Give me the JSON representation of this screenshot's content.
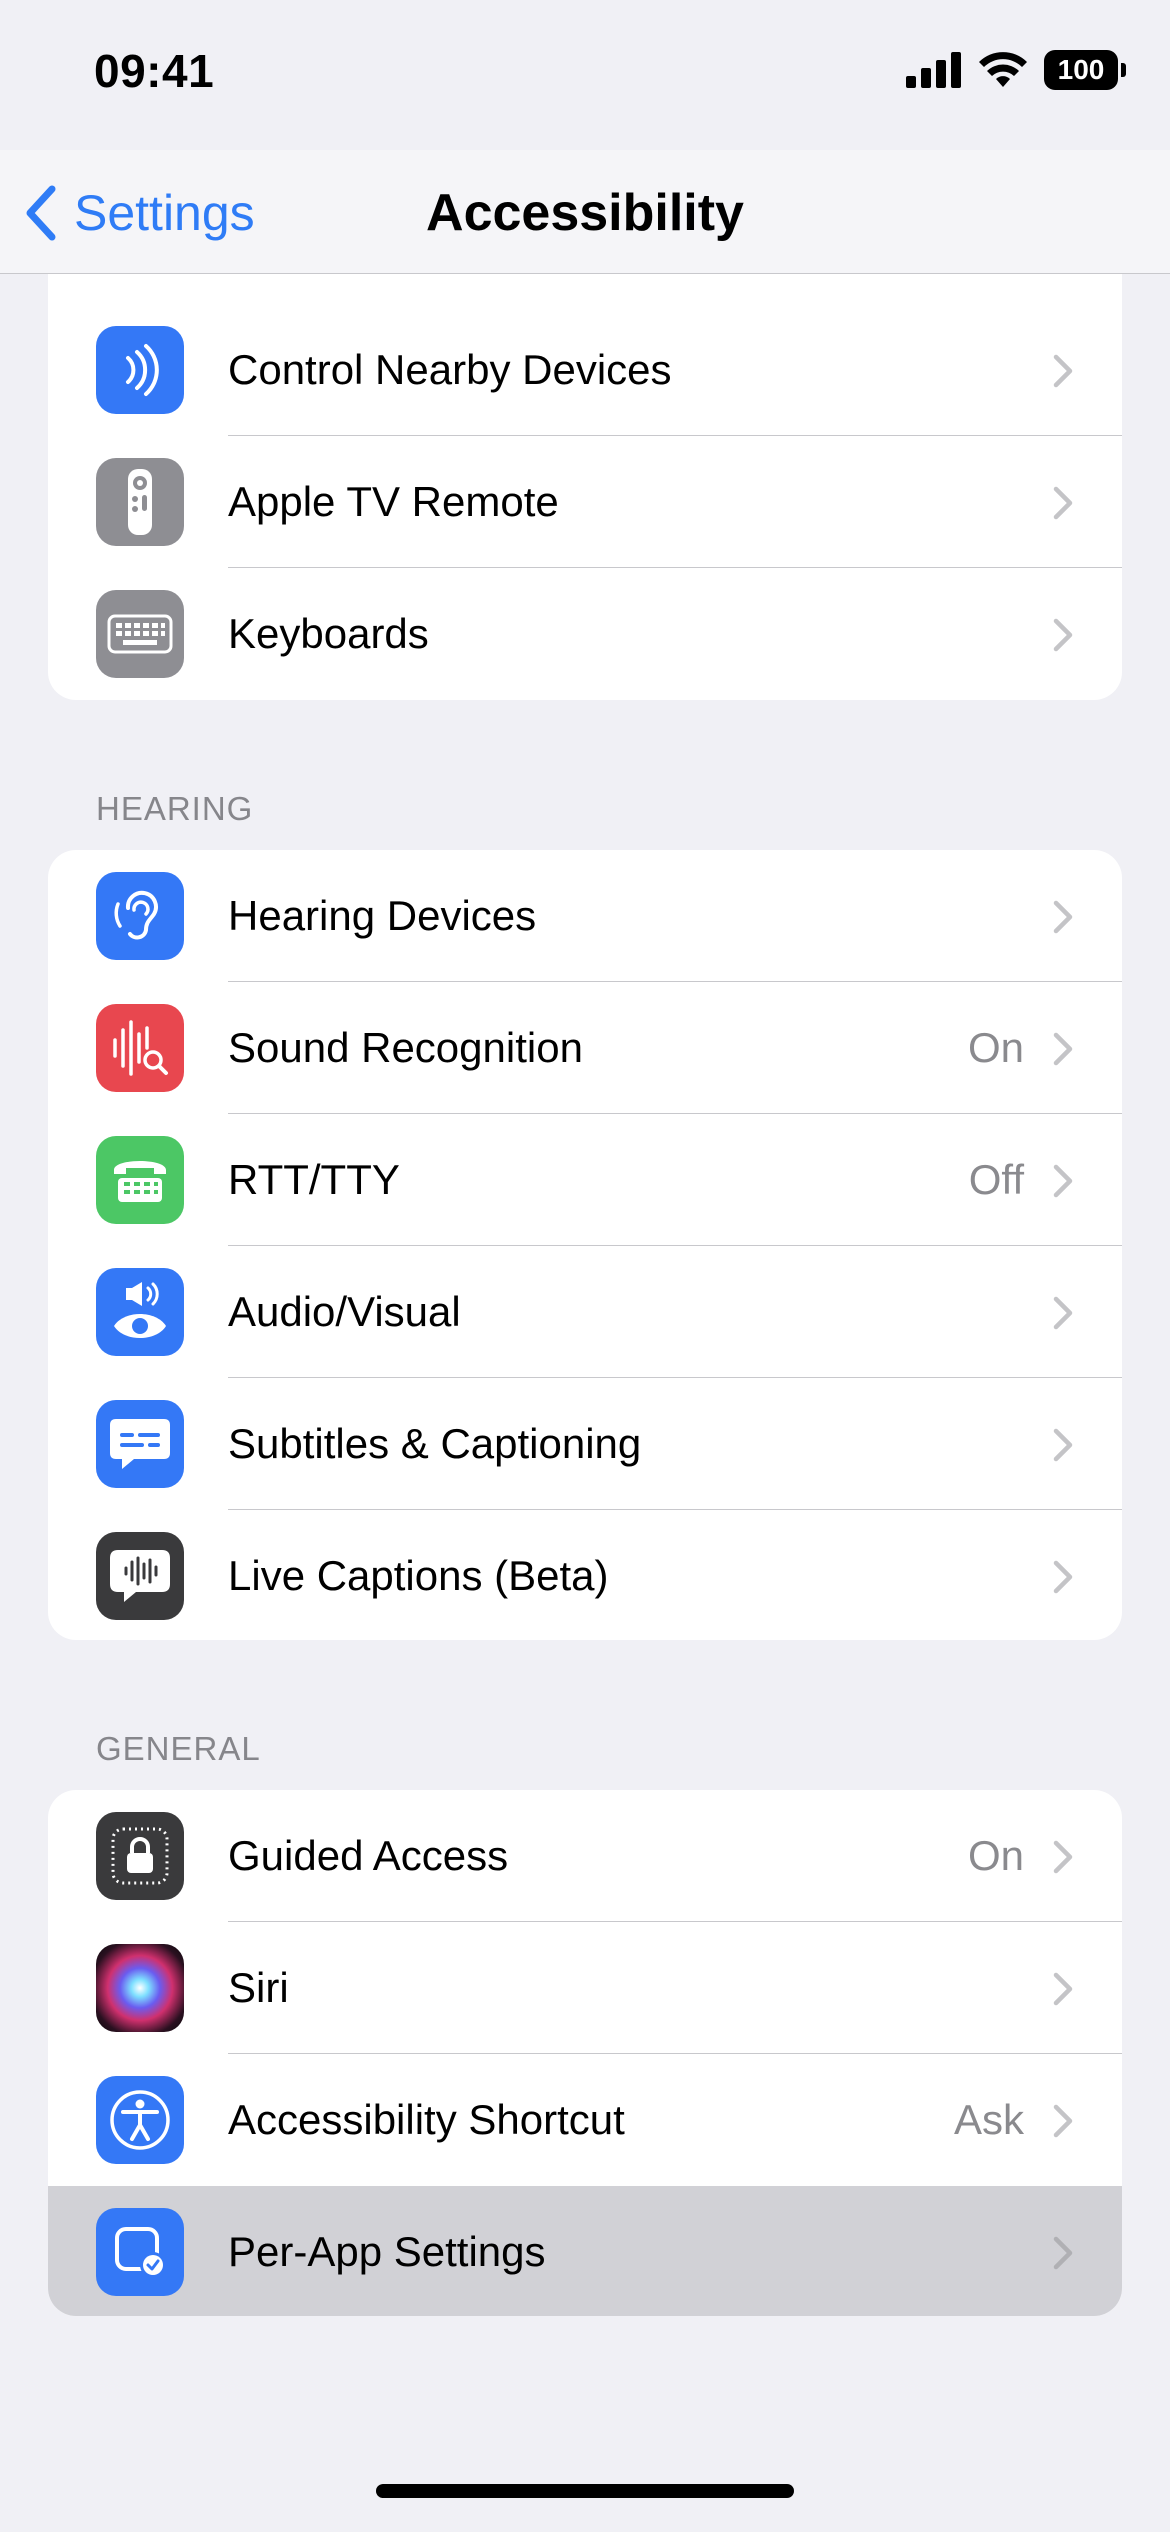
{
  "status_bar": {
    "time": "09:41",
    "battery": "100"
  },
  "nav": {
    "back_label": "Settings",
    "title": "Accessibility"
  },
  "groups": [
    {
      "header": "",
      "rows": [
        {
          "label": "Control Nearby Devices",
          "value": "",
          "icon": "control-nearby-devices-icon",
          "color": "#3478f6"
        },
        {
          "label": "Apple TV Remote",
          "value": "",
          "icon": "apple-tv-remote-icon",
          "color": "#8e8e93"
        },
        {
          "label": "Keyboards",
          "value": "",
          "icon": "keyboard-icon",
          "color": "#8e8e93"
        }
      ]
    },
    {
      "header": "HEARING",
      "rows": [
        {
          "label": "Hearing Devices",
          "value": "",
          "icon": "ear-icon",
          "color": "#3478f6"
        },
        {
          "label": "Sound Recognition",
          "value": "On",
          "icon": "sound-recognition-icon",
          "color": "#e8474f"
        },
        {
          "label": "RTT/TTY",
          "value": "Off",
          "icon": "tty-icon",
          "color": "#4cc765"
        },
        {
          "label": "Audio/Visual",
          "value": "",
          "icon": "audio-visual-icon",
          "color": "#3478f6"
        },
        {
          "label": "Subtitles & Captioning",
          "value": "",
          "icon": "subtitles-icon",
          "color": "#3478f6"
        },
        {
          "label": "Live Captions (Beta)",
          "value": "",
          "icon": "live-captions-icon",
          "color": "#3a3a3c"
        }
      ]
    },
    {
      "header": "GENERAL",
      "rows": [
        {
          "label": "Guided Access",
          "value": "On",
          "icon": "guided-access-icon",
          "color": "#3a3a3c"
        },
        {
          "label": "Siri",
          "value": "",
          "icon": "siri-icon",
          "color": "#1c1c1e"
        },
        {
          "label": "Accessibility Shortcut",
          "value": "Ask",
          "icon": "accessibility-icon",
          "color": "#3478f6"
        },
        {
          "label": "Per-App Settings",
          "value": "",
          "icon": "per-app-settings-icon",
          "color": "#3478f6",
          "highlighted": true
        }
      ]
    }
  ]
}
